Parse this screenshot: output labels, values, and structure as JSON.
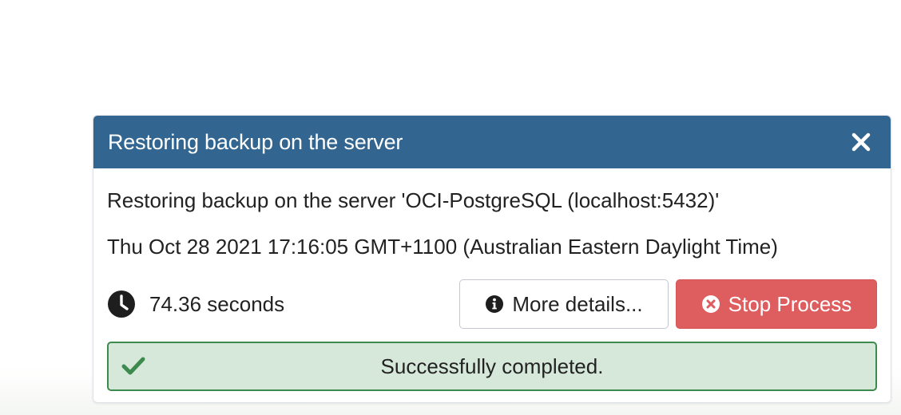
{
  "notifier": {
    "title": "Restoring backup on the server",
    "description": "Restoring backup on the server 'OCI-PostgreSQL (localhost:5432)'",
    "timestamp": "Thu Oct 28 2021 17:16:05 GMT+1100 (Australian Eastern Daylight Time)",
    "elapsed": "74.36 seconds",
    "more_details_label": "More details...",
    "stop_process_label": "Stop Process",
    "status_message": "Successfully completed."
  },
  "colors": {
    "header": "#326690",
    "stop_button": "#de5d5f",
    "success_border": "#3c8a4d",
    "success_background": "#d6e8da"
  },
  "icons": {
    "close": "close-icon",
    "clock": "clock-icon",
    "info": "info-icon",
    "stop": "x-circle-icon",
    "success": "checkmark-icon"
  }
}
